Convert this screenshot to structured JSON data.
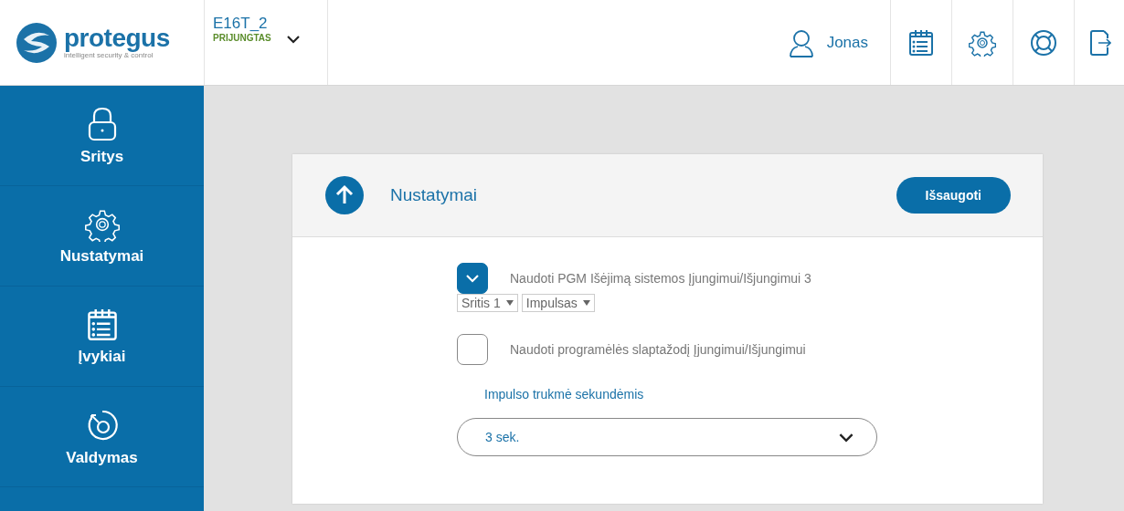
{
  "logo": {
    "name": "protegus",
    "tagline": "intelligent security & control"
  },
  "device": {
    "name": "E16T_2",
    "status": "PRIJUNGTAS"
  },
  "user": {
    "name": "Jonas"
  },
  "sidebar": {
    "items": [
      {
        "label": "Sritys",
        "kind": "lock"
      },
      {
        "label": "Nustatymai",
        "kind": "gear"
      },
      {
        "label": "Įvykiai",
        "kind": "calendar"
      },
      {
        "label": "Valdymas",
        "kind": "control"
      }
    ]
  },
  "panel": {
    "title": "Nustatymai",
    "save_button": "Išsaugoti",
    "options": [
      {
        "label": "Naudoti PGM Išėjimą sistemos Įjungimui/Išjungimui 3",
        "checked": true,
        "selects": [
          "Sritis 1",
          "Impulsas"
        ]
      },
      {
        "label": "Naudoti programėlės slaptažodį Įjungimui/Išjungimui",
        "checked": false
      }
    ],
    "duration": {
      "label": "Impulso trukmė sekundėmis",
      "value": "3 sek."
    }
  }
}
